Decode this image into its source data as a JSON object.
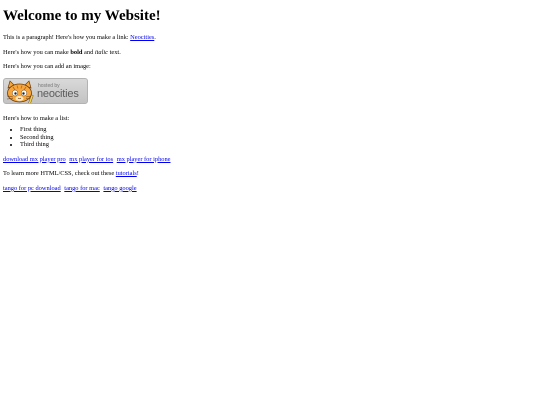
{
  "heading": "Welcome to my Website!",
  "paragraph1": {
    "before_link": "This is a paragraph! Here's how you make a link: ",
    "link_text": "Neocities",
    "after_link": "."
  },
  "paragraph2": {
    "before_bold": "Here's how you can make ",
    "bold_text": "bold",
    "between": " and ",
    "italic_text": "italic",
    "after": " text."
  },
  "image_intro": "Here's how you can add an image:",
  "badge": {
    "small_text": "hosted by",
    "big_text": "neocities",
    "colors": {
      "orange": "#f6a63a",
      "gray_bg": "#cfcfcf",
      "text": "#5c5c5c"
    },
    "icon": "neocities-cat-icon"
  },
  "list_intro": "Here's how to make a list:",
  "list_items": [
    "First thing",
    "Second thing",
    "Third thing"
  ],
  "links_row1": [
    "download mx player pro",
    "mx player for ios",
    "mx player for iphone"
  ],
  "learn_more": {
    "before_link": "To learn more HTML/CSS, check out these ",
    "link_text": "tutorials",
    "after_link": "!"
  },
  "links_row2": [
    "tango for pc download",
    "tango for mac",
    "tango google"
  ]
}
